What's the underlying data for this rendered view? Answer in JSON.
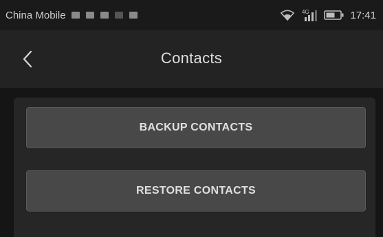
{
  "status_bar": {
    "carrier": "China Mobile",
    "network": "4G",
    "time": "17:41",
    "icons": [
      "notification-icon",
      "notification-icon",
      "notification-icon",
      "notification-icon",
      "notification-icon",
      "wifi-icon",
      "signal-icon",
      "battery-icon"
    ]
  },
  "app_bar": {
    "title": "Contacts"
  },
  "actions": {
    "backup_label": "BACKUP CONTACTS",
    "restore_label": "RESTORE CONTACTS"
  },
  "colors": {
    "background": "#1e1e1e",
    "app_bar": "#232323",
    "button": "#484848",
    "text": "#e0e0e0"
  }
}
